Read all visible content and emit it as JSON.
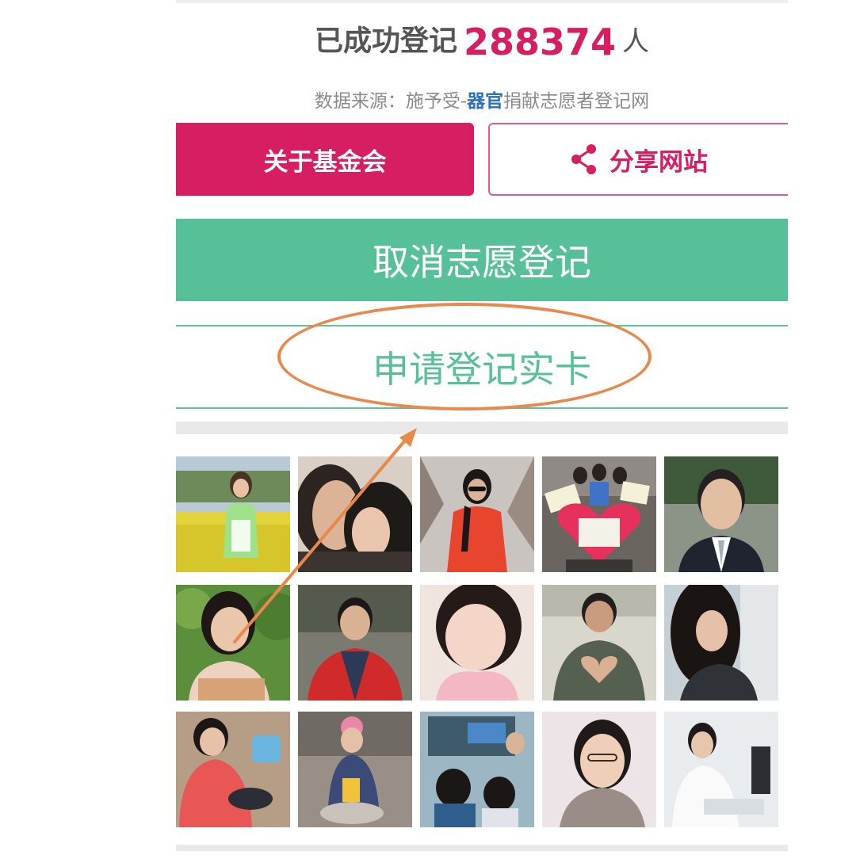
{
  "registration": {
    "prefix": "已成功登记",
    "count": "288374",
    "unit": "人"
  },
  "source": {
    "before": "数据来源：施予受-",
    "highlight": "器官",
    "after": "捐献志愿者登记网"
  },
  "buttons": {
    "about_label": "关于基金会",
    "share_label": "分享网站",
    "cancel_label": "取消志愿登记",
    "apply_card_label": "申请登记实卡"
  },
  "icons": {
    "share": "share-icon"
  },
  "colors": {
    "brand_pink": "#d81e63",
    "brand_green": "#56c098",
    "annotation_orange": "#e8884a",
    "source_highlight": "#2a6fc4"
  },
  "photos": [
    {
      "name": "photo-woman-rapeseed-field"
    },
    {
      "name": "photo-couple-kiss"
    },
    {
      "name": "photo-woman-red-jacket-sunglasses"
    },
    {
      "name": "photo-group-heart-sign"
    },
    {
      "name": "photo-man-suit"
    },
    {
      "name": "photo-woman-short-hair-garden"
    },
    {
      "name": "photo-man-red-jacket"
    },
    {
      "name": "photo-woman-selfie-pink-scarf"
    },
    {
      "name": "photo-person-heart-hands"
    },
    {
      "name": "photo-woman-long-hair-window"
    },
    {
      "name": "photo-woman-crouching-red-coat"
    },
    {
      "name": "photo-woman-pink-hat-outdoors"
    },
    {
      "name": "photo-classroom-children"
    },
    {
      "name": "photo-woman-glasses-scarf"
    },
    {
      "name": "photo-doctor-white-coat"
    }
  ]
}
